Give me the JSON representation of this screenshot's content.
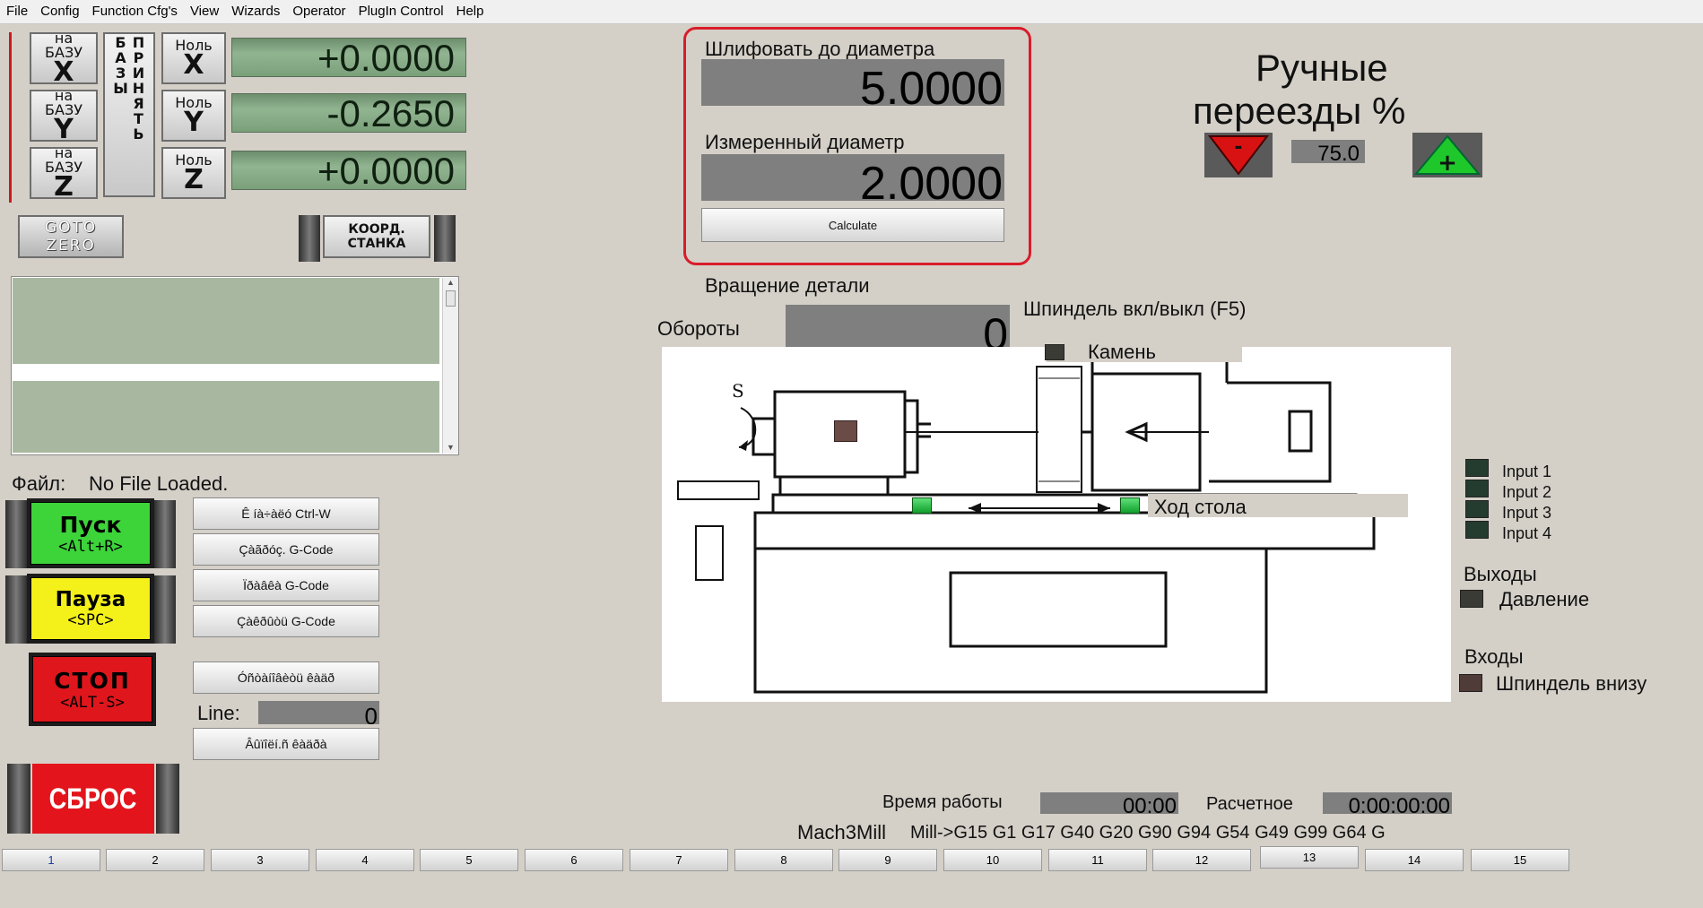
{
  "menu": [
    "File",
    "Config",
    "Function Cfg's",
    "View",
    "Wizards",
    "Operator",
    "PlugIn Control",
    "Help"
  ],
  "dro": {
    "ref_x": {
      "top": "на",
      "mid": "БАЗУ",
      "axis": "X"
    },
    "ref_y": {
      "top": "на",
      "mid": "БАЗУ",
      "axis": "Y"
    },
    "ref_z": {
      "top": "на",
      "mid": "БАЗУ",
      "axis": "Z"
    },
    "ref_all_label": "ПРИНЯТЬ БАЗЫ",
    "zero_x": {
      "top": "Ноль",
      "axis": "X"
    },
    "zero_y": {
      "top": "Ноль",
      "axis": "Y"
    },
    "zero_z": {
      "top": "Ноль",
      "axis": "Z"
    },
    "x_value": "+0.0000",
    "y_value": "-0.2650",
    "z_value": "+0.0000"
  },
  "goto_zero": {
    "line1": "GOTO",
    "line2": "ZERO"
  },
  "machine_coords": {
    "line1": "КООРД.",
    "line2": "СТАНКА"
  },
  "grind": {
    "title1": "Шлифовать до диаметра",
    "value1": "5.0000",
    "title2": "Измеренный диаметр",
    "value2": "2.0000",
    "calc_label": "Calculate",
    "accent": "#d91c2a"
  },
  "jog": {
    "title1": "Ручные",
    "title2": "переезды %",
    "value": "75.0",
    "minus": "-",
    "plus": "+"
  },
  "spindle": {
    "rotation_label": "Вращение детали",
    "rpm_label": "Обороты",
    "rpm_value": "0",
    "toggle_label": "Шпиндель вкл/выкл (F5)",
    "stone_label": "Камень",
    "table_travel_label": "Ход стола"
  },
  "file": {
    "label": "Файл:",
    "value": "No File Loaded."
  },
  "run": {
    "start": {
      "line1": "Пуск",
      "line2": "<Alt+R>",
      "color": "#3dd43a"
    },
    "pause": {
      "line1": "Пауза",
      "line2": "<SPC>",
      "color": "#f4f01a"
    },
    "stop": {
      "line1": "СТОП",
      "line2": "<ALT-S>",
      "color": "#e0161d"
    },
    "reset": {
      "label": "СБРОС",
      "color": "#e3141b"
    }
  },
  "file_buttons": [
    "Ê íà÷àëó Ctrl-W",
    "Çàãðóç. G-Code",
    "Ïðàâêà G-Code",
    "Çàêðûòü G-Code",
    "Óñòàíîâèòü êàäð",
    "Âûïîëí.ñ êàäðà"
  ],
  "line": {
    "label": "Line:",
    "value": "0"
  },
  "inputs": [
    "Input 1",
    "Input 2",
    "Input 3",
    "Input 4"
  ],
  "outputs": {
    "title": "Выходы",
    "item": "Давление"
  },
  "ins": {
    "title": "Входы",
    "item": "Шпиндель внизу"
  },
  "status": {
    "runtime_label": "Время работы",
    "runtime_value": "00:00",
    "est_label": "Расчетное",
    "est_value": "0:00:00:00",
    "profile": "Mach3Mill",
    "gcodes": "Mill->G15  G1 G17 G40 G20 G90 G94 G54 G49 G99 G64 G"
  },
  "tabs": [
    "1",
    "2",
    "3",
    "4",
    "5",
    "6",
    "7",
    "8",
    "9",
    "10",
    "11",
    "12",
    "13",
    "14",
    "15"
  ]
}
